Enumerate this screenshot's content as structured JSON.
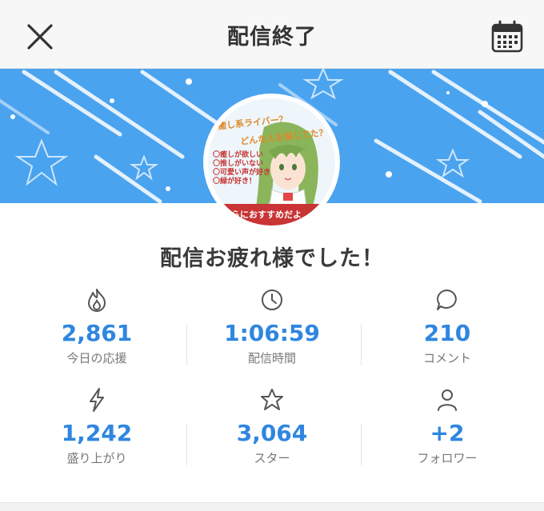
{
  "header": {
    "title": "配信終了",
    "close_icon": "close-icon",
    "calendar_icon": "calendar-icon"
  },
  "banner": {
    "color": "#4aa3ef",
    "thumbnail": {
      "line1": "癒し系ライバー？",
      "line2": "どんな人を探してた？",
      "list": [
        "〇癒しが欲しい",
        "〇推しがいない",
        "〇可愛い声が好き",
        "〇緑が好き！"
      ],
      "footer": "ならにおすすめだよ"
    }
  },
  "greeting": "配信お疲れ様でした！",
  "stats": [
    {
      "icon": "flame-icon",
      "value": "2,861",
      "label": "今日の応援"
    },
    {
      "icon": "clock-icon",
      "value": "1:06:59",
      "label": "配信時間"
    },
    {
      "icon": "comment-icon",
      "value": "210",
      "label": "コメント"
    },
    {
      "icon": "lightning-icon",
      "value": "1,242",
      "label": "盛り上がり"
    },
    {
      "icon": "star-icon",
      "value": "3,064",
      "label": "スター"
    },
    {
      "icon": "person-icon",
      "value": "+2",
      "label": "フォロワー"
    }
  ],
  "accent_color": "#2f86e0"
}
